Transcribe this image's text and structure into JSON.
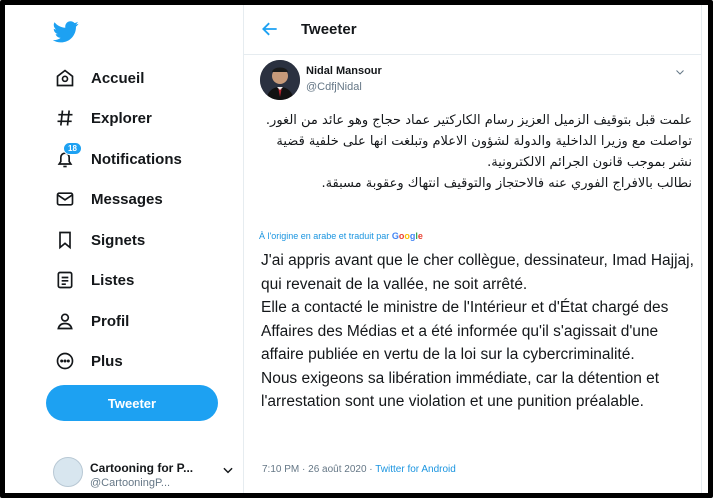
{
  "colors": {
    "brand": "#1da1f2",
    "link": "#1b95e0",
    "muted": "#657786",
    "text": "#14171a"
  },
  "sidebar": {
    "logo_icon": "twitter-bird-icon",
    "items": [
      {
        "label": "Accueil",
        "icon": "home-icon"
      },
      {
        "label": "Explorer",
        "icon": "hashtag-icon"
      },
      {
        "label": "Notifications",
        "icon": "bell-icon",
        "badge": "18"
      },
      {
        "label": "Messages",
        "icon": "envelope-icon"
      },
      {
        "label": "Signets",
        "icon": "bookmark-icon"
      },
      {
        "label": "Listes",
        "icon": "list-icon"
      },
      {
        "label": "Profil",
        "icon": "person-icon"
      },
      {
        "label": "Plus",
        "icon": "more-circle-icon"
      }
    ],
    "tweet_button": "Tweeter",
    "account": {
      "name": "Cartooning for P...",
      "handle": "@CartooningP..."
    }
  },
  "header": {
    "title": "Tweeter"
  },
  "tweet": {
    "author_name": "Nidal Mansour",
    "author_handle": "@CdfjNidal",
    "text_ar": "علمت قبل بتوقيف الزميل العزيز رسام الكاركتير عماد حجاج وهو عائد من الغور.\nتواصلت مع وزيرا الداخلية والدولة لشؤون الاعلام وتبلغت انها على خلفية قضية نشر بموجب قانون الجرائم الالكترونية.\nنطالب بالافراج الفوري عنه فالاحتجاز والتوقيف انتهاك وعقوبة مسبقة.",
    "translated_note": "À l'origine en arabe et traduit par",
    "translated_by": "Google",
    "text_fr": "J'ai appris avant que le cher collègue, dessinateur, Imad Hajjaj, qui revenait de la vallée, ne soit arrêté.\n Elle a contacté le ministre de l'Intérieur et d'État chargé des Affaires des Médias et a été informée qu'il s'agissait d'une affaire publiée en vertu de la loi sur la cybercriminalité.\n Nous exigeons sa libération immédiate, car la détention et l'arrestation sont une violation et une punition préalable.",
    "time": "7:10 PM · 26 août 2020 · ",
    "source": "Twitter for Android"
  }
}
